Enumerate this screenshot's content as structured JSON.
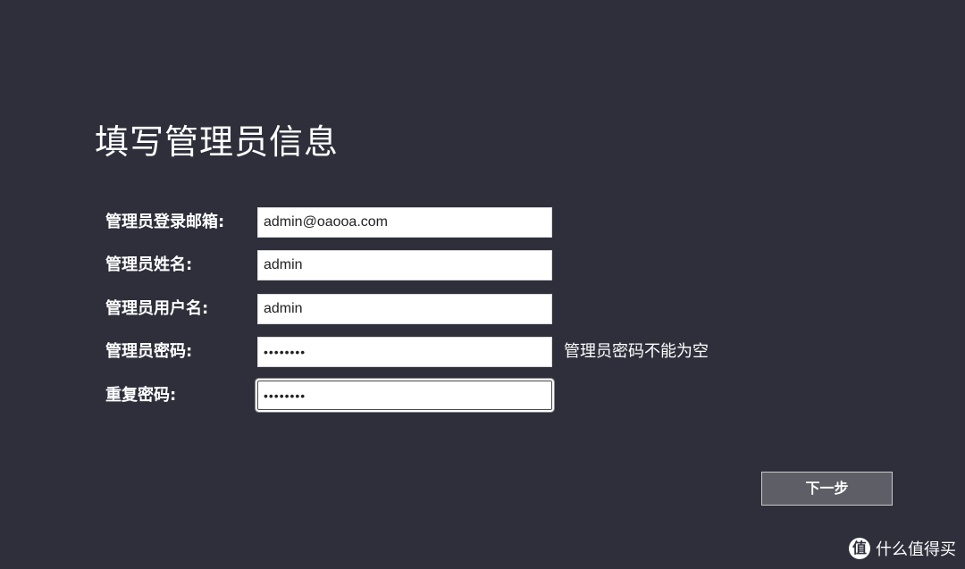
{
  "page": {
    "title": "填写管理员信息"
  },
  "form": {
    "email": {
      "label": "管理员登录邮箱:",
      "value": "admin@oaooa.com"
    },
    "name": {
      "label": "管理员姓名:",
      "value": "admin"
    },
    "username": {
      "label": "管理员用户名:",
      "value": "admin"
    },
    "password": {
      "label": "管理员密码:",
      "value": "••••••••",
      "hint": "管理员密码不能为空"
    },
    "confirm_password": {
      "label": "重复密码:",
      "value": "••••••••"
    }
  },
  "actions": {
    "next_label": "下一步"
  },
  "watermark": {
    "logo_glyph": "值",
    "text": "什么值得买"
  },
  "colors": {
    "background": "#2e2f3b",
    "button": "#5d5e66",
    "text": "#ffffff"
  }
}
